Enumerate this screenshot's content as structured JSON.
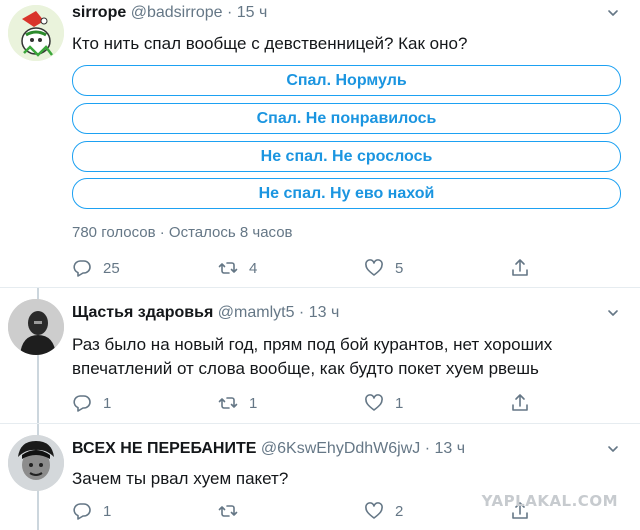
{
  "tweets": [
    {
      "display_name": "sirrope",
      "handle": "@badsirrope",
      "separator": "·",
      "time": "15 ч",
      "text": "Кто нить спал вообще с девственницей? Как оно?",
      "poll": {
        "options": [
          "Спал. Нормуль",
          "Спал. Не понравилось",
          "Не спал. Не срослось",
          "Не спал. Ну ево нахой"
        ],
        "info": "780 голосов · Осталось 8 часов"
      },
      "actions": {
        "replies": "25",
        "retweets": "4",
        "likes": "5"
      }
    },
    {
      "display_name": "Щастья здаровья",
      "handle": "@mamlyt5",
      "separator": "·",
      "time": "13 ч",
      "text": "Раз было на новый год, прям под бой курантов, нет хороших впечатлений от слова вообще, как будто покет хуем рвешь",
      "actions": {
        "replies": "1",
        "retweets": "1",
        "likes": "1"
      }
    },
    {
      "display_name": "ВСЕХ НЕ ПЕРЕБАНИТЕ",
      "handle": "@6KswEhyDdhW6jwJ",
      "separator": "·",
      "time": "13 ч",
      "text": "Зачем ты рвал хуем пакет?",
      "actions": {
        "replies": "1",
        "retweets": "",
        "likes": "2"
      }
    }
  ],
  "watermark": "YAPLAKAL.COM",
  "colors": {
    "accent": "#1da1f2",
    "muted": "#657786",
    "divider": "#e6ecf0",
    "text": "#14171a"
  },
  "icons": [
    "reply-icon",
    "retweet-icon",
    "like-icon",
    "share-icon",
    "caret-down-icon"
  ]
}
